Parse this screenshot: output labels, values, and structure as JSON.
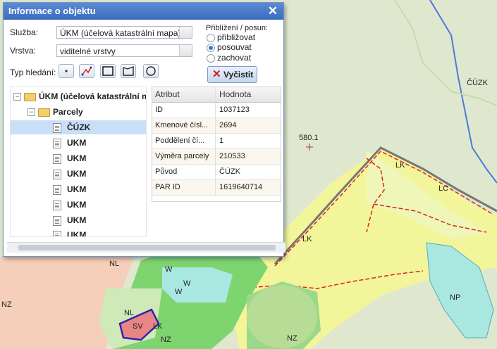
{
  "dialog": {
    "title": "Informace o objektu",
    "service_label": "Služba:",
    "service_value": "ÚKM (účelová katastrální mapa)",
    "layer_label": "Vrstva:",
    "layer_value": "viditelné vrstvy",
    "search_type_label": "Typ hledání:",
    "zoom_pan_label": "Přiblížení / posun:",
    "radio_options": [
      {
        "label": "přibližovat",
        "checked": false
      },
      {
        "label": "posouvat",
        "checked": true
      },
      {
        "label": "zachovat",
        "checked": false
      }
    ],
    "clear_button": "Vyčistit",
    "tree": {
      "root": "ÚKM (účelová katastrální m",
      "group": "Parcely",
      "items": [
        "ČÚZK",
        "UKM",
        "UKM",
        "UKM",
        "UKM",
        "UKM",
        "UKM",
        "UKM"
      ]
    },
    "attributes": {
      "header": [
        "Atribut",
        "Hodnota"
      ],
      "rows": [
        [
          "ID",
          "1037123"
        ],
        [
          "Kmenové čísl...",
          "2694"
        ],
        [
          "Poddělení čí...",
          "1"
        ],
        [
          "Výměra parcely",
          "210533"
        ],
        [
          "Původ",
          "ČÚZK"
        ],
        [
          "PAR ID",
          "1619640714"
        ]
      ]
    }
  },
  "map": {
    "labels": {
      "cuzk": "ČÚZK",
      "elev": "580.1",
      "lk1": "LK",
      "lk2": "LK",
      "lc": "LC",
      "np": "NP",
      "nl1": "NL",
      "nl2": "NL",
      "nz1": "NZ",
      "nz2": "NZ",
      "nz3": "NZ",
      "w1": "W",
      "w2": "W",
      "w3": "W",
      "sv": "SV",
      "lk3": "LK"
    },
    "colors": {
      "meadow": "#d9e6c4",
      "yellow_zone": "#f2f59a",
      "green_zone": "#7ed46f",
      "water": "#a8e8e0",
      "orange_zone": "#f5cfb9",
      "sv_fill": "#e88585",
      "river": "#4f78d6"
    }
  }
}
